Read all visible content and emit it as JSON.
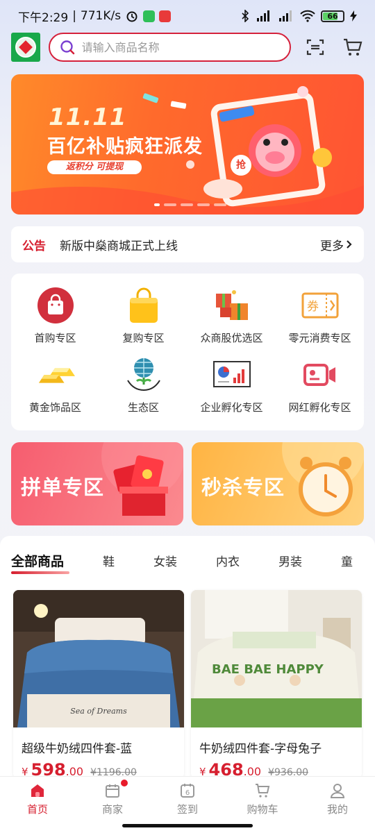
{
  "status_bar": {
    "time": "下午2:29",
    "speed": "771K/s",
    "battery": "66"
  },
  "search": {
    "placeholder": "请输入商品名称"
  },
  "banner": {
    "title_1": "11.11",
    "title_2": "百亿补贴疯狂派发",
    "button": "返积分 可提现",
    "badge": "抢"
  },
  "notice": {
    "tag": "公告",
    "text": "新版中燊商城正式上线",
    "more": "更多"
  },
  "categories": [
    {
      "label": "首购专区",
      "icon": "shopping-bag-icon"
    },
    {
      "label": "复购专区",
      "icon": "gold-bag-icon"
    },
    {
      "label": "众商股优选区",
      "icon": "gift-boxes-icon"
    },
    {
      "label": "零元消费专区",
      "icon": "coupon-icon"
    },
    {
      "label": "黄金饰品区",
      "icon": "gold-bars-icon"
    },
    {
      "label": "生态区",
      "icon": "globe-hands-icon"
    },
    {
      "label": "企业孵化专区",
      "icon": "chart-board-icon"
    },
    {
      "label": "网红孵化专区",
      "icon": "video-camera-icon"
    }
  ],
  "promos": [
    {
      "label": "拼单专区",
      "color": "#f65d6f"
    },
    {
      "label": "秒杀专区",
      "color": "#ffb443"
    }
  ],
  "tabs": [
    "全部商品",
    "鞋",
    "女装",
    "内衣",
    "男装",
    "童"
  ],
  "products": [
    {
      "title": "超级牛奶绒四件套-蓝",
      "yen": "¥",
      "price": "598",
      "decimal": ".00",
      "old_price": "¥1196.00",
      "image_text": "Sea of Dreams"
    },
    {
      "title": "牛奶绒四件套-字母兔子",
      "yen": "¥",
      "price": "468",
      "decimal": ".00",
      "old_price": "¥936.00",
      "image_text": "BAE BAE HAPPY"
    }
  ],
  "tabbar": [
    {
      "label": "首页",
      "icon": "home-icon",
      "active": true
    },
    {
      "label": "商家",
      "icon": "store-icon",
      "badge": true
    },
    {
      "label": "签到",
      "icon": "calendar-icon",
      "day": "6"
    },
    {
      "label": "购物车",
      "icon": "cart-icon"
    },
    {
      "label": "我的",
      "icon": "user-icon"
    }
  ],
  "colors": {
    "brand": "#d61f2f",
    "logo_green": "#19a84a",
    "banner": "#ff6a2c"
  }
}
